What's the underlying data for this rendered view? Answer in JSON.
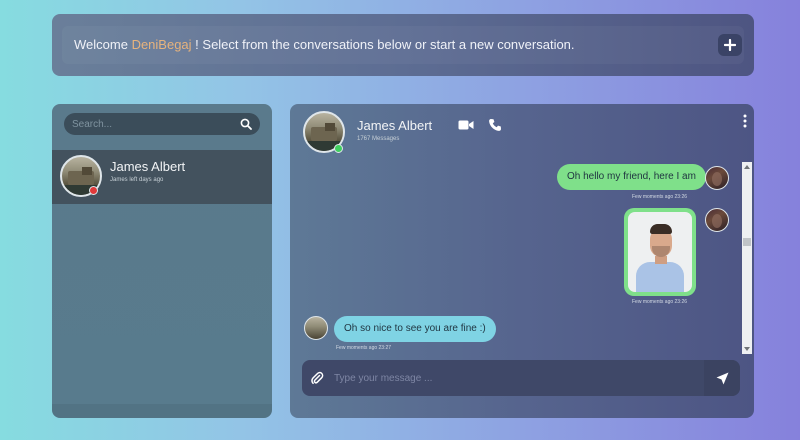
{
  "welcome": {
    "prefix": "Welcome ",
    "username": "DeniBegaj",
    "suffix": " ! Select from the conversations below or start a new conversation.",
    "new_conversation_icon": "plus-icon"
  },
  "sidebar": {
    "search": {
      "placeholder": "Search...",
      "value": "",
      "icon": "search-icon"
    },
    "contacts": [
      {
        "name": "James Albert",
        "subtitle": "James left days ago",
        "status": "offline",
        "status_color": "#e23a3a"
      }
    ]
  },
  "chat": {
    "contact_name": "James Albert",
    "message_count": "1767 Messages",
    "status_color": "#3fcf5f",
    "icons": {
      "video": "video-camera-icon",
      "call": "phone-icon",
      "menu": "more-vertical-icon"
    },
    "messages": [
      {
        "direction": "outgoing",
        "type": "text",
        "text": "Oh hello my friend, here I am",
        "time": "Few moments ago 23:26"
      },
      {
        "direction": "outgoing",
        "type": "image",
        "alt": "Portrait photo of a man",
        "time": "Few moments ago 23:26"
      },
      {
        "direction": "incoming",
        "type": "text",
        "text": "Oh so nice to see you are fine :)",
        "time": "Few moments ago 23:27"
      }
    ],
    "composer": {
      "placeholder": "Type your message ...",
      "value": "",
      "attach_icon": "paperclip-icon",
      "send_icon": "send-icon"
    }
  },
  "colors": {
    "outgoing_bubble": "#7fe08a",
    "incoming_bubble": "#7fd3e4",
    "username_accent": "#e7b37d"
  }
}
